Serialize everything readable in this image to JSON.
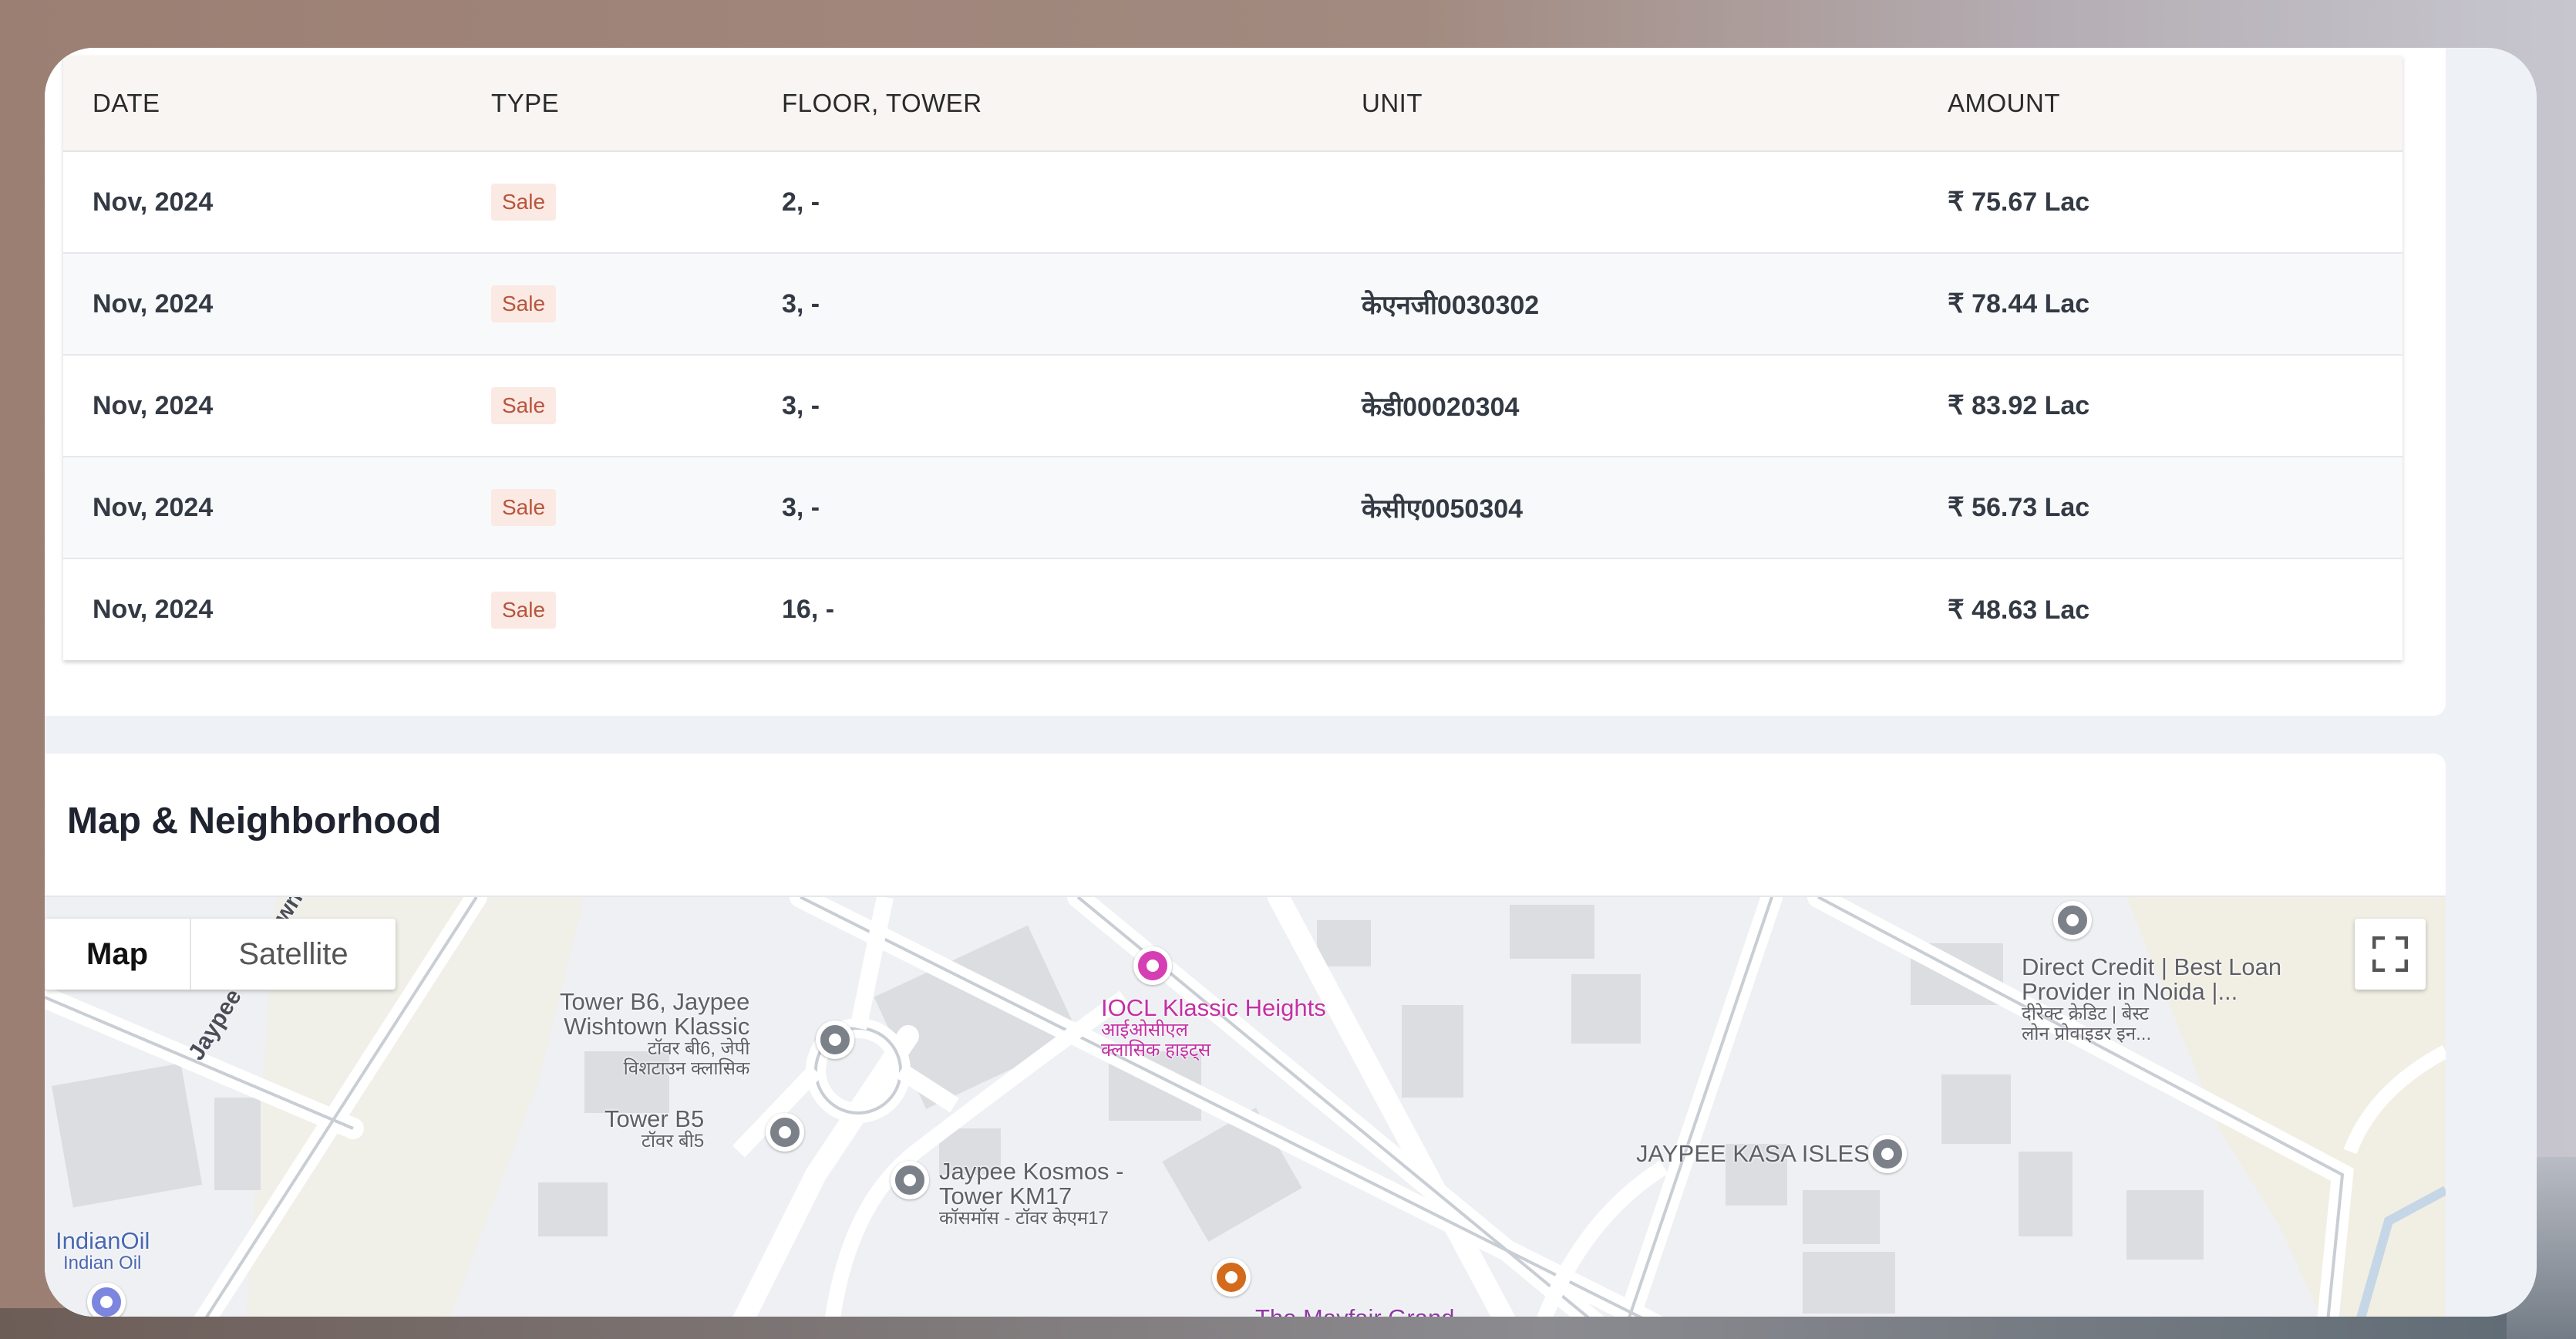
{
  "transactions": {
    "headers": {
      "date": "DATE",
      "type": "TYPE",
      "floor_tower": "FLOOR, TOWER",
      "unit": "UNIT",
      "amount": "AMOUNT"
    },
    "rows": [
      {
        "date": "Nov, 2024",
        "type": "Sale",
        "floor_tower": "2, -",
        "unit": "",
        "amount": "₹ 75.67 Lac"
      },
      {
        "date": "Nov, 2024",
        "type": "Sale",
        "floor_tower": "3, -",
        "unit": "केएनजी0030302",
        "amount": "₹ 78.44 Lac"
      },
      {
        "date": "Nov, 2024",
        "type": "Sale",
        "floor_tower": "3, -",
        "unit": "केडी00020304",
        "amount": "₹ 83.92 Lac"
      },
      {
        "date": "Nov, 2024",
        "type": "Sale",
        "floor_tower": "3, -",
        "unit": "केसीए0050304",
        "amount": "₹ 56.73 Lac"
      },
      {
        "date": "Nov, 2024",
        "type": "Sale",
        "floor_tower": "16, -",
        "unit": "",
        "amount": "₹ 48.63 Lac"
      }
    ]
  },
  "map_section": {
    "title": "Map & Neighborhood",
    "map_type_map": "Map",
    "map_type_satellite": "Satellite",
    "fullscreen_icon": "fullscreen-icon",
    "labels": {
      "tower_b6": "Tower B6, Jaypee",
      "tower_b6_2": "Wishtown Klassic",
      "tower_b6_hi": "टॉवर बी6, जेपी",
      "tower_b6_hi2": "विशटाउन क्लासिक",
      "tower_b5": "Tower B5",
      "tower_b5_hi": "टॉवर बी5",
      "kosmos": "Jaypee Kosmos -",
      "kosmos_2": "Tower KM17",
      "kosmos_hi": "कॉसमॉस - टॉवर केएम17",
      "iocl": "IOCL Klassic Heights",
      "iocl_hi": "आईओसीएल",
      "iocl_hi2": "क्लासिक हाइट्स",
      "direct_credit": "Direct Credit | Best Loan",
      "direct_credit_2": "Provider in Noida |...",
      "direct_credit_hi": "दीरेक्ट क्रेडिट | बेस्ट",
      "direct_credit_hi2": "लोन प्रोवाइडर इन...",
      "kasa": "JAYPEE KASA ISLES",
      "indianoil": "IndianOil",
      "indianoil_2": "Indian Oil",
      "road": "Jaypee Wishtown Internal Rd",
      "mayfair": "The Mayfair Grand"
    }
  },
  "colors": {
    "sale_badge_bg": "#fbe9e4",
    "sale_badge_text": "#b7553b",
    "poi_pink": "#c52fa5"
  }
}
